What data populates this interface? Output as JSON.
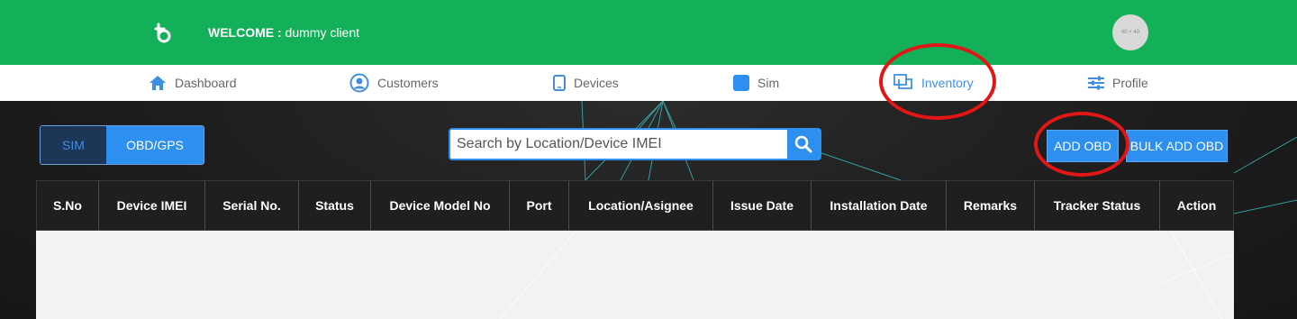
{
  "header": {
    "welcome_label": "WELCOME :",
    "user_name": "dummy client",
    "avatar_text": "40 × 40"
  },
  "nav": [
    {
      "label": "Dashboard",
      "icon": "home-icon"
    },
    {
      "label": "Customers",
      "icon": "user-circle-icon"
    },
    {
      "label": "Devices",
      "icon": "tablet-icon"
    },
    {
      "label": "Sim",
      "icon": "sim-icon"
    },
    {
      "label": "Inventory",
      "icon": "inventory-icon",
      "active": true
    },
    {
      "label": "Profile",
      "icon": "sliders-icon"
    }
  ],
  "toggle": {
    "sim_label": "SIM",
    "obd_label": "OBD/GPS",
    "selected": "OBD/GPS"
  },
  "search": {
    "placeholder": "Search by Location/Device IMEI",
    "value": ""
  },
  "actions": {
    "add_obd_label": "ADD OBD",
    "bulk_add_label": "BULK ADD OBD"
  },
  "table": {
    "columns": [
      "S.No",
      "Device IMEI",
      "Serial No.",
      "Status",
      "Device Model No",
      "Port",
      "Location/Asignee",
      "Issue Date",
      "Installation Date",
      "Remarks",
      "Tracker Status",
      "Action"
    ],
    "rows": []
  },
  "colors": {
    "brand_green": "#14b059",
    "accent_blue": "#2d8ff0",
    "annotation_red": "#e11616"
  }
}
